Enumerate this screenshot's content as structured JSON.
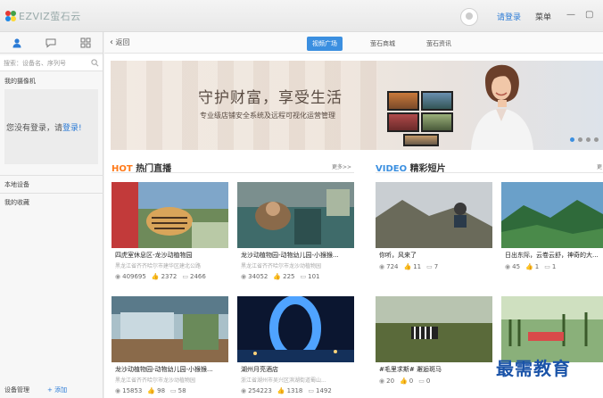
{
  "app": {
    "logo_text": "EZVIZ萤石云",
    "login_label": "请登录",
    "menu_label": "菜单",
    "window_buttons": {
      "minimize": "—",
      "maximize": "▢"
    }
  },
  "sidebar": {
    "tabs": [
      {
        "icon": "user-icon"
      },
      {
        "icon": "chat-icon"
      },
      {
        "icon": "grid-icon"
      }
    ],
    "search_placeholder": "搜索：设备名、序列号",
    "my_cameras_label": "我的摄像机",
    "empty_text": "您没有登录，请",
    "empty_link": "登录!",
    "local_devices_label": "本地设备",
    "favorites_label": "我的收藏",
    "bottom_manage": "设备管理",
    "bottom_add": "+ 添加"
  },
  "nav": {
    "back_label": "返回",
    "tabs": [
      {
        "label": "视频广场",
        "active": true
      },
      {
        "label": "萤石商城",
        "active": false
      },
      {
        "label": "萤石资讯",
        "active": false
      }
    ]
  },
  "banner": {
    "title": "守护财富，享受生活",
    "subtitle": "专业级店铺安全系统及远程可视化运营管理",
    "slide_count": 4,
    "active_slide": 1
  },
  "hot": {
    "prefix": "HOT",
    "title": "热门直播",
    "more": "更多>>",
    "cards": [
      {
        "title": "四虎室休息区-龙沙动植物园",
        "addr": "黑龙江省齐齐哈尔市建华区建北公路",
        "views": "409695",
        "likes": "2372",
        "comments": "2466"
      },
      {
        "title": "龙沙动植物园-动物幼儿园-小猴猴...",
        "addr": "黑龙江省齐齐哈尔市龙沙动植物园",
        "views": "34052",
        "likes": "225",
        "comments": "101"
      },
      {
        "title": "龙沙动植物园-动物幼儿园-小猴猴...",
        "addr": "黑龙江省齐齐哈尔市龙沙动植物园",
        "views": "15853",
        "likes": "98",
        "comments": "58"
      },
      {
        "title": "湖州月亮酒店",
        "addr": "浙江省湖州市吴兴区滨湖街道蜀山...",
        "views": "254223",
        "likes": "1318",
        "comments": "1492"
      }
    ]
  },
  "video": {
    "prefix": "VIDEO",
    "title": "精彩短片",
    "more": "更",
    "cards": [
      {
        "title": "你听，风来了",
        "views": "724",
        "likes": "11",
        "comments": "7"
      },
      {
        "title": "日出东际，云卷云舒，神奇的大...",
        "views": "45",
        "likes": "1",
        "comments": "1"
      },
      {
        "title": "#毛里求斯# 邂逅斑马",
        "views": "20",
        "likes": "0",
        "comments": "0"
      },
      {
        "title": "",
        "views": "",
        "likes": "",
        "comments": ""
      }
    ]
  },
  "watermark": "最需教育"
}
